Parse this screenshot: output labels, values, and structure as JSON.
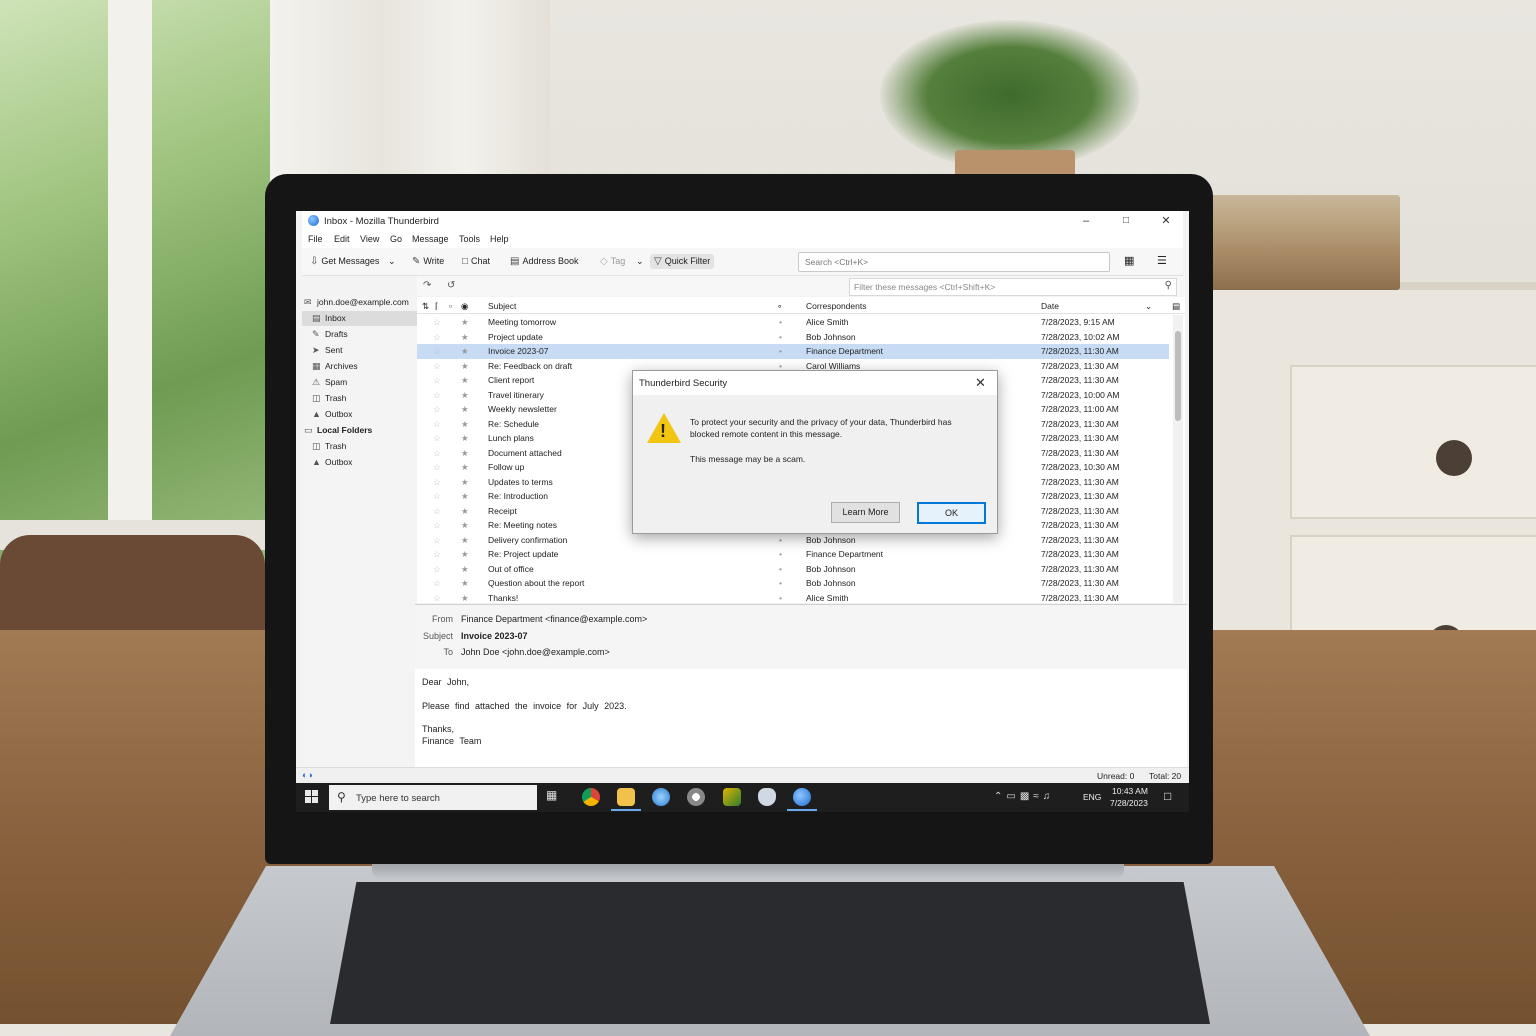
{
  "window": {
    "title": "Inbox - Mozilla Thunderbird"
  },
  "menu": [
    "File",
    "Edit",
    "View",
    "Go",
    "Message",
    "Tools",
    "Help"
  ],
  "toolbar": {
    "get_messages": "Get Messages",
    "write": "Write",
    "chat": "Chat",
    "address_book": "Address Book",
    "tag": "Tag",
    "quick_filter": "Quick Filter",
    "search_placeholder": "Search <Ctrl+K>"
  },
  "filter": {
    "placeholder": "Filter these messages <Ctrl+Shift+K>"
  },
  "folders": [
    {
      "label": "john.doe@example.com",
      "type": "account"
    },
    {
      "label": "Inbox",
      "type": "folder",
      "selected": true
    },
    {
      "label": "Drafts",
      "type": "folder"
    },
    {
      "label": "Sent",
      "type": "folder"
    },
    {
      "label": "Archives",
      "type": "folder"
    },
    {
      "label": "Spam",
      "type": "folder"
    },
    {
      "label": "Trash",
      "type": "folder"
    },
    {
      "label": "Outbox",
      "type": "folder"
    },
    {
      "label": "Local Folders",
      "type": "account"
    },
    {
      "label": "Trash",
      "type": "folder"
    },
    {
      "label": "Outbox",
      "type": "folder"
    }
  ],
  "columns": {
    "subject": "Subject",
    "correspondents": "Correspondents",
    "date": "Date"
  },
  "messages": [
    {
      "subject": "Meeting tomorrow",
      "from": "Alice Smith",
      "date": "7/28/2023, 9:15 AM"
    },
    {
      "subject": "Project update",
      "from": "Bob Johnson",
      "date": "7/28/2023, 10:02 AM"
    },
    {
      "subject": "Invoice 2023-07",
      "from": "Finance Department",
      "date": "7/28/2023, 11:30 AM",
      "selected": true
    },
    {
      "subject": "Re: Feedback on draft",
      "from": "Carol Williams",
      "date": "7/28/2023, 11:30 AM"
    },
    {
      "subject": "Client report",
      "from": "",
      "date": "7/28/2023, 11:30 AM"
    },
    {
      "subject": "Travel itinerary",
      "from": "",
      "date": "7/28/2023, 10:00 AM"
    },
    {
      "subject": "Weekly newsletter",
      "from": "",
      "date": "7/28/2023, 11:00 AM"
    },
    {
      "subject": "Re: Schedule",
      "from": "",
      "date": "7/28/2023, 11:30 AM"
    },
    {
      "subject": "Lunch plans",
      "from": "",
      "date": "7/28/2023, 11:30 AM"
    },
    {
      "subject": "Document attached",
      "from": "",
      "date": "7/28/2023, 11:30 AM"
    },
    {
      "subject": "Follow up",
      "from": "",
      "date": "7/28/2023, 10:30 AM"
    },
    {
      "subject": "Updates to terms",
      "from": "",
      "date": "7/28/2023, 11:30 AM"
    },
    {
      "subject": "Re: Introduction",
      "from": "",
      "date": "7/28/2023, 11:30 AM"
    },
    {
      "subject": "Receipt",
      "from": "",
      "date": "7/28/2023, 11:30 AM"
    },
    {
      "subject": "Re: Meeting notes",
      "from": "",
      "date": "7/28/2023, 11:30 AM"
    },
    {
      "subject": "Delivery confirmation",
      "from": "Bob Johnson",
      "date": "7/28/2023, 11:30 AM"
    },
    {
      "subject": "Re: Project update",
      "from": "Finance Department",
      "date": "7/28/2023, 11:30 AM"
    },
    {
      "subject": "Out of office",
      "from": "Bob Johnson",
      "date": "7/28/2023, 11:30 AM"
    },
    {
      "subject": "Question about the report",
      "from": "Bob Johnson",
      "date": "7/28/2023, 11:30 AM"
    },
    {
      "subject": "Thanks!",
      "from": "Alice Smith",
      "date": "7/28/2023, 11:30 AM"
    }
  ],
  "preview": {
    "from_label": "From",
    "from": "Finance Department <finance@example.com>",
    "subject_label": "Subject",
    "subject": "Invoice 2023-07",
    "to_label": "To",
    "to": "John Doe <john.doe@example.com>",
    "body": [
      "Dear John,",
      "Please find attached the invoice for July 2023.",
      "Thanks,",
      "Finance Team"
    ]
  },
  "status": {
    "unread": "Unread: 0",
    "total": "Total: 20"
  },
  "dialog": {
    "title": "Thunderbird Security",
    "message": "To protect your security and the privacy of your data, Thunderbird has blocked remote content in this message.",
    "message2": "This message may be a scam.",
    "learn_more": "Learn More",
    "ok": "OK"
  },
  "taskbar": {
    "search_placeholder": "Type here to search",
    "lang": "ENG",
    "time": "10:43 AM",
    "date": "7/28/2023"
  },
  "colors": {
    "accent": "#0078d7",
    "selection": "#c7dcf4",
    "warning": "#f2c511",
    "taskbar": "#1e1e1e"
  }
}
